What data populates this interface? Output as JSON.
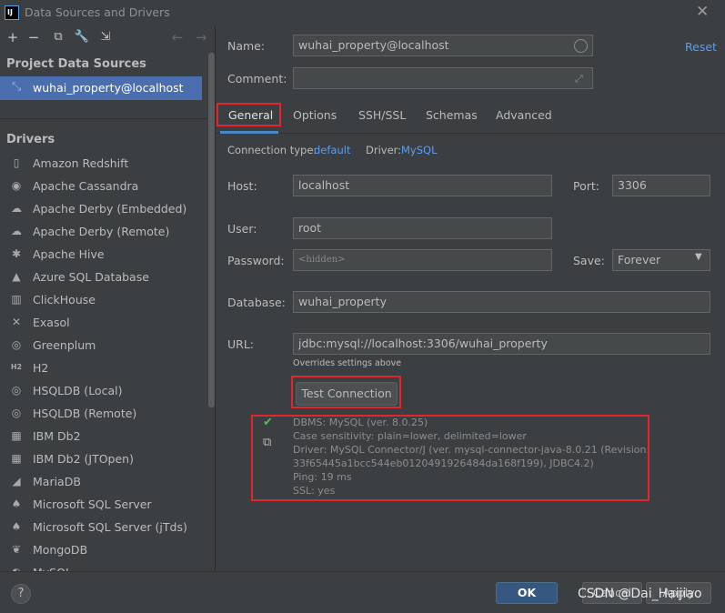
{
  "window": {
    "title": "Data Sources and Drivers",
    "app_logo": "IJ"
  },
  "sidebar": {
    "project_sources_title": "Project Data Sources",
    "selected_source": "wuhai_property@localhost",
    "drivers_title": "Drivers",
    "drivers": [
      {
        "label": "Amazon Redshift",
        "icon": "redshift-icon",
        "glyph": "▯"
      },
      {
        "label": "Apache Cassandra",
        "icon": "cassandra-icon",
        "glyph": "◉"
      },
      {
        "label": "Apache Derby (Embedded)",
        "icon": "derby-icon",
        "glyph": "☁"
      },
      {
        "label": "Apache Derby (Remote)",
        "icon": "derby-icon",
        "glyph": "☁"
      },
      {
        "label": "Apache Hive",
        "icon": "hive-icon",
        "glyph": "✱"
      },
      {
        "label": "Azure SQL Database",
        "icon": "azure-icon",
        "glyph": "▲"
      },
      {
        "label": "ClickHouse",
        "icon": "clickhouse-icon",
        "glyph": "▥"
      },
      {
        "label": "Exasol",
        "icon": "exasol-icon",
        "glyph": "✕"
      },
      {
        "label": "Greenplum",
        "icon": "greenplum-icon",
        "glyph": "◎"
      },
      {
        "label": "H2",
        "icon": "h2-icon",
        "glyph": "H2"
      },
      {
        "label": "HSQLDB (Local)",
        "icon": "hsqldb-icon",
        "glyph": "◎"
      },
      {
        "label": "HSQLDB (Remote)",
        "icon": "hsqldb-icon",
        "glyph": "◎"
      },
      {
        "label": "IBM Db2",
        "icon": "db2-icon",
        "glyph": "▦"
      },
      {
        "label": "IBM Db2 (JTOpen)",
        "icon": "db2-icon",
        "glyph": "▦"
      },
      {
        "label": "MariaDB",
        "icon": "mariadb-icon",
        "glyph": "◢"
      },
      {
        "label": "Microsoft SQL Server",
        "icon": "sqlserver-icon",
        "glyph": "♠"
      },
      {
        "label": "Microsoft SQL Server (jTds)",
        "icon": "sqlserver-icon",
        "glyph": "♠"
      },
      {
        "label": "MongoDB",
        "icon": "mongodb-icon",
        "glyph": "❦"
      },
      {
        "label": "MySQL",
        "icon": "mysql-icon",
        "glyph": "◐"
      }
    ]
  },
  "form": {
    "name_label": "Name:",
    "name_value": "wuhai_property@localhost",
    "reset_label": "Reset",
    "comment_label": "Comment:",
    "comment_value": "",
    "tabs": [
      "General",
      "Options",
      "SSH/SSL",
      "Schemas",
      "Advanced"
    ],
    "connection_type_label": "Connection type:",
    "connection_type_value": "default",
    "driver_label": "Driver:",
    "driver_value": "MySQL",
    "host_label": "Host:",
    "host_value": "localhost",
    "port_label": "Port:",
    "port_value": "3306",
    "user_label": "User:",
    "user_value": "root",
    "password_label": "Password:",
    "password_value": "<hidden>",
    "save_label": "Save:",
    "save_value": "Forever",
    "database_label": "Database:",
    "database_value": "wuhai_property",
    "url_label": "URL:",
    "url_value": "jdbc:mysql://localhost:3306/wuhai_property",
    "url_hint": "Overrides settings above",
    "test_connection_label": "Test Connection",
    "status_lines": "DBMS: MySQL (ver. 8.0.25)\nCase sensitivity: plain=lower, delimited=lower\nDriver: MySQL Connector/J (ver. mysql-connector-java-8.0.21 (Revision:\n33f65445a1bcc544eb0120491926484da168f199), JDBC4.2)\nPing: 19 ms\nSSL: yes"
  },
  "footer": {
    "help_label": "?",
    "ok_label": "OK",
    "cancel_label": "Cancel",
    "apply_label": "Apply",
    "watermark": "CSDN @Dai_Haijiao"
  },
  "colors": {
    "accent_selection": "#4b6eaf",
    "link": "#589df6",
    "annotation_red": "#e0272e",
    "success_check": "#5fb35f"
  }
}
